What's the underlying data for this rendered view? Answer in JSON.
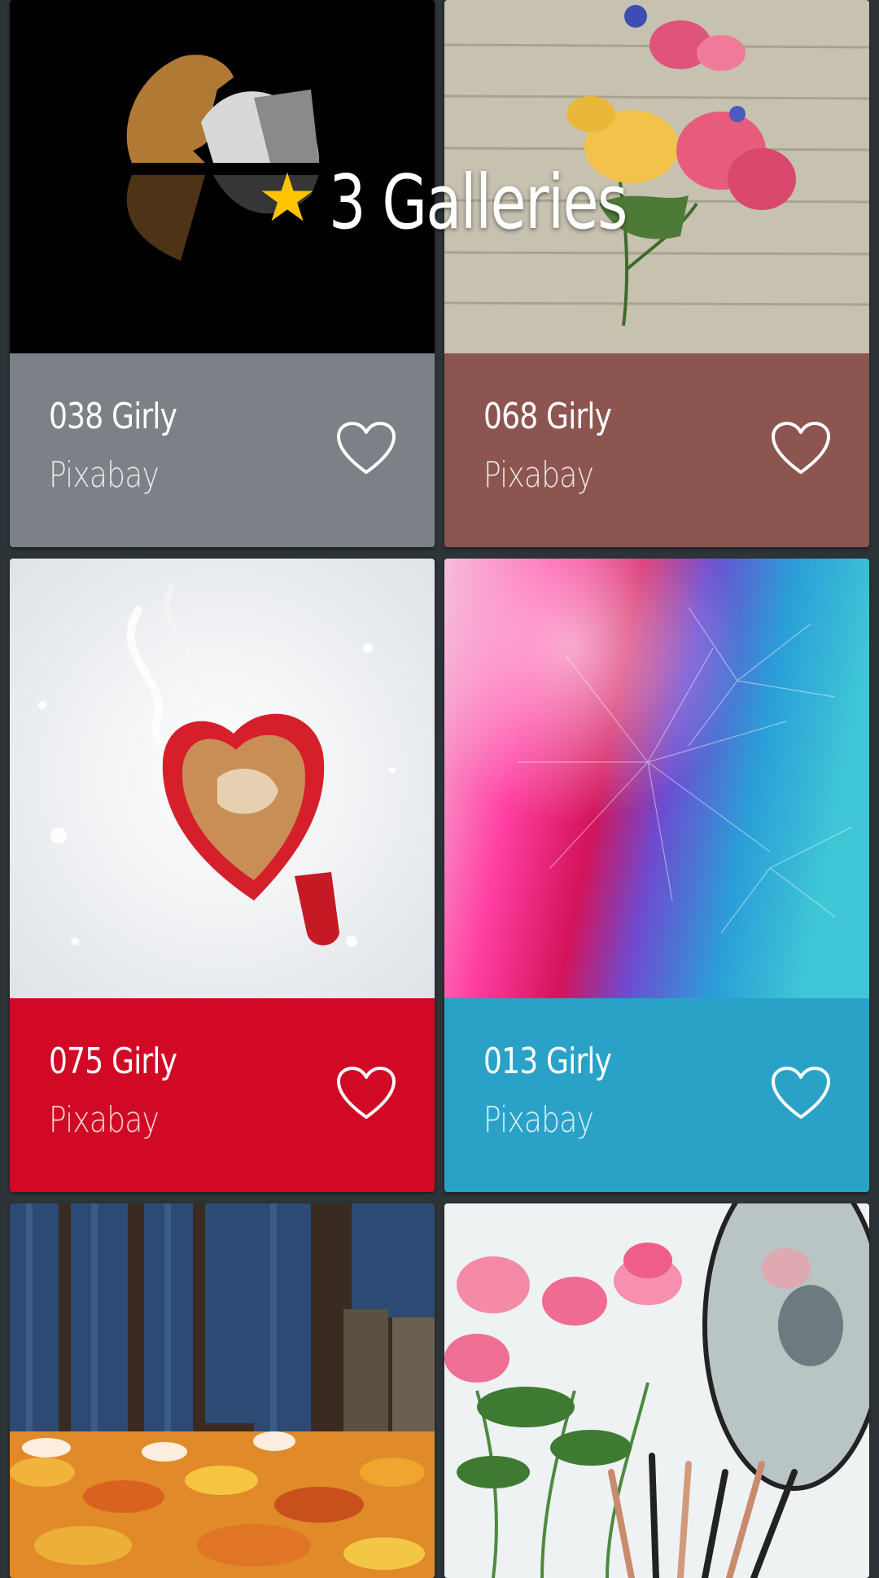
{
  "banner": {
    "icon": "star-icon",
    "star_color": "#ffc400",
    "text": "3 Galleries"
  },
  "cards": [
    {
      "title": "038 Girly",
      "source": "Pixabay",
      "info_color": "#7b8186",
      "image": "chess-knights-on-black"
    },
    {
      "title": "068 Girly",
      "source": "Pixabay",
      "info_color": "#8d5550",
      "image": "roses-on-wooden-planks"
    },
    {
      "title": "075 Girly",
      "source": "Pixabay",
      "info_color": "#d10925",
      "image": "heart-coffee-cup-in-snow"
    },
    {
      "title": "013 Girly",
      "source": "Pixabay",
      "info_color": "#2aa2c8",
      "image": "colorful-dandelion"
    },
    {
      "image": "jeans-on-autumn-leaves"
    },
    {
      "image": "pink-roses-and-makeup-brushes"
    }
  ]
}
